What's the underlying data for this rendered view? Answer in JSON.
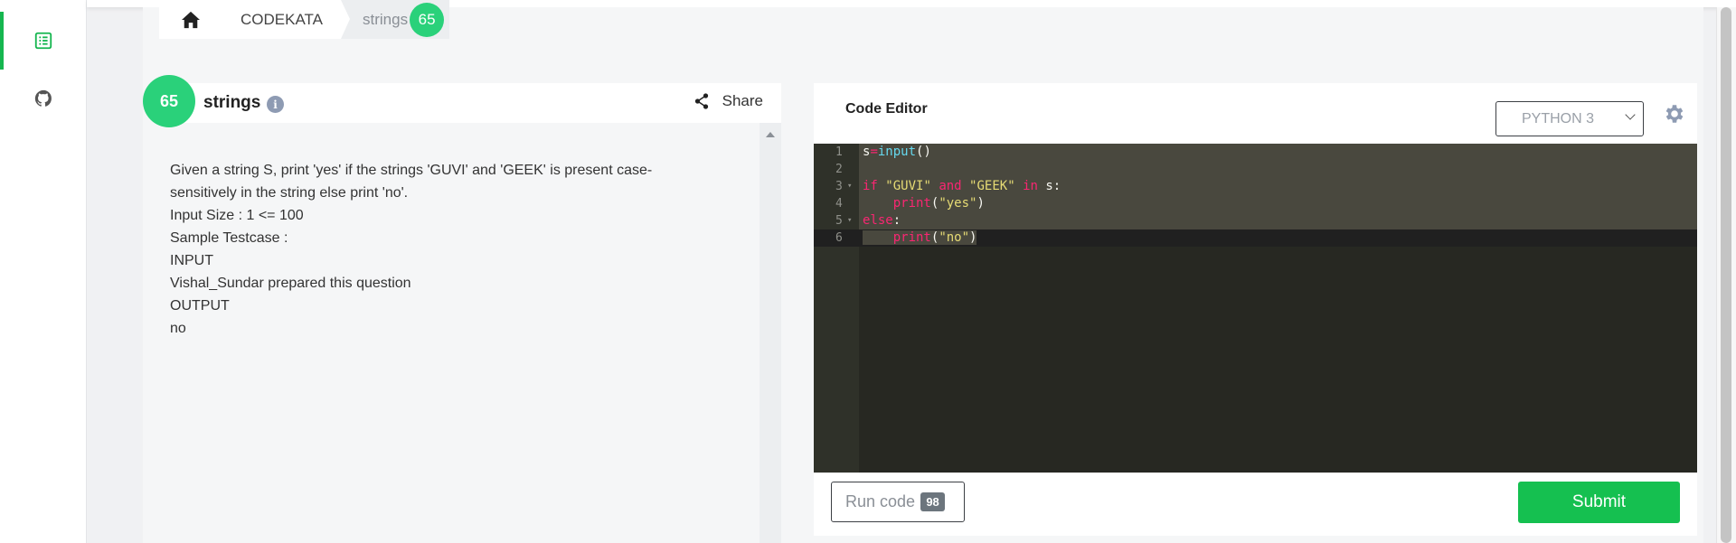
{
  "sidebar": {
    "items": [
      {
        "name": "problems",
        "icon": "list-icon",
        "active": true
      },
      {
        "name": "github",
        "icon": "github-icon",
        "active": false
      }
    ]
  },
  "breadcrumb": {
    "home_icon": "home-icon",
    "section": "CODEKATA",
    "current": "strings",
    "current_count": "65"
  },
  "problem": {
    "number": "65",
    "title": "strings",
    "info_icon": "info-icon",
    "share_label": "Share",
    "lines": [
      "Given a string S, print 'yes' if the strings 'GUVI' and 'GEEK' is present case-",
      "sensitively in the string else print 'no'.",
      "Input Size : 1 <= 100",
      "Sample Testcase :",
      "INPUT",
      "Vishal_Sundar prepared this question",
      "OUTPUT",
      "no"
    ]
  },
  "editor": {
    "title": "Code Editor",
    "language": "PYTHON 3",
    "settings_icon": "gear-icon",
    "code_lines": [
      "s=input()",
      "",
      "if \"GUVI\" and \"GEEK\" in s:",
      "    print(\"yes\")",
      "else:",
      "    print(\"no\")"
    ],
    "line_numbers": [
      "1",
      "2",
      "3",
      "4",
      "5",
      "6"
    ],
    "run_label": "Run code",
    "run_count": "98",
    "submit_label": "Submit"
  },
  "colors": {
    "accent": "#2ad17a",
    "submit": "#15c050",
    "editor_bg": "#272822"
  }
}
